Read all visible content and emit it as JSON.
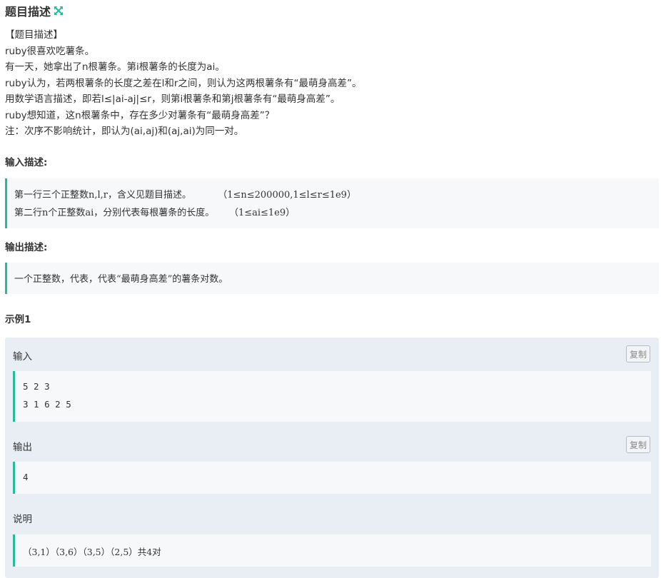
{
  "header": {
    "title": "题目描述",
    "icon": "expand-icon"
  },
  "description": {
    "lines": [
      "【题目描述】",
      "ruby很喜欢吃薯条。",
      "有一天，她拿出了n根薯条。第i根薯条的长度为ai。",
      "ruby认为，若两根薯条的长度之差在l和r之间，则认为这两根薯条有“最萌身高差”。",
      "用数学语言描述，即若l≤|ai-aj|≤r，则第i根薯条和第j根薯条有“最萌身高差”。",
      "ruby想知道，这n根薯条中，存在多少对薯条有“最萌身高差”？",
      "注：次序不影响统计，即认为(ai,aj)和(aj,ai)为同一对。"
    ]
  },
  "input_desc": {
    "title": "输入描述:",
    "lines": [
      "第一行三个正整数n,l,r，含义见题目描述。         （1≤n≤200000,1≤l≤r≤1e9）",
      "第二行n个正整数ai，分别代表每根薯条的长度。     （1≤ai≤1e9）"
    ]
  },
  "output_desc": {
    "title": "输出描述:",
    "lines": [
      "一个正整数，代表，代表“最萌身高差”的薯条对数。"
    ]
  },
  "example": {
    "title": "示例1",
    "input_label": "输入",
    "input_lines": [
      "5 2 3",
      "3 1 6 2 5"
    ],
    "output_label": "输出",
    "output_lines": [
      "4"
    ],
    "explain_label": "说明",
    "explain_lines": [
      "（3,1）（3,6）（3,5）（2,5）共4对"
    ],
    "copy_label": "复制"
  },
  "colors": {
    "accent": "#25bb9b",
    "example_bg": "#e9edf4",
    "code_bg": "#f7f8fa"
  }
}
